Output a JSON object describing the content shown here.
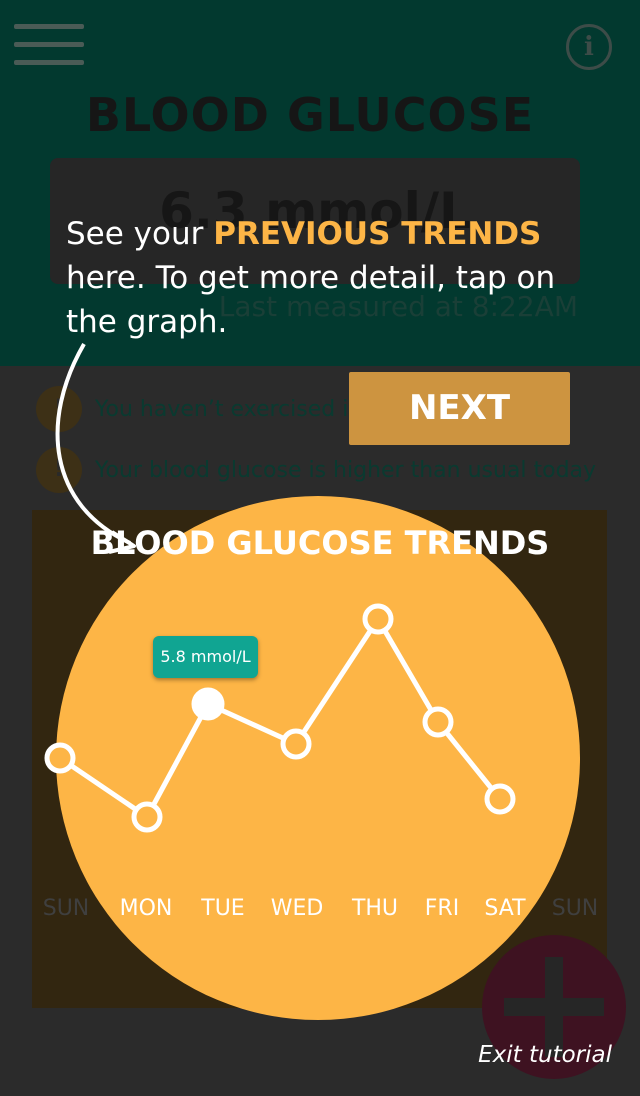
{
  "header": {
    "title": "BLOOD GLUCOSE",
    "reading": "6.3 mmol/L",
    "last_measured": "Last measured at 8:22AM"
  },
  "alerts": [
    {
      "badge": "!",
      "text": "You haven’t exercised in 5 days"
    },
    {
      "badge": "!",
      "text": "Your blood glucose is higher than usual today"
    }
  ],
  "trends": {
    "title": "BLOOD GLUCOSE TRENDS",
    "tooltip": "5.8 mmol/L",
    "days": [
      "SUN",
      "MON",
      "TUE",
      "WED",
      "THU",
      "FRI",
      "SAT",
      "SUN"
    ]
  },
  "tutorial": {
    "text_before": "See your ",
    "highlight": "PREVIOUS TRENDS",
    "text_after": " here. To get more detail, tap on the graph.",
    "next_label": "NEXT",
    "exit_label": "Exit tutorial"
  },
  "colors": {
    "accent": "#fdb546",
    "tooltip": "#10a592",
    "header_bg": "#02392f"
  }
}
